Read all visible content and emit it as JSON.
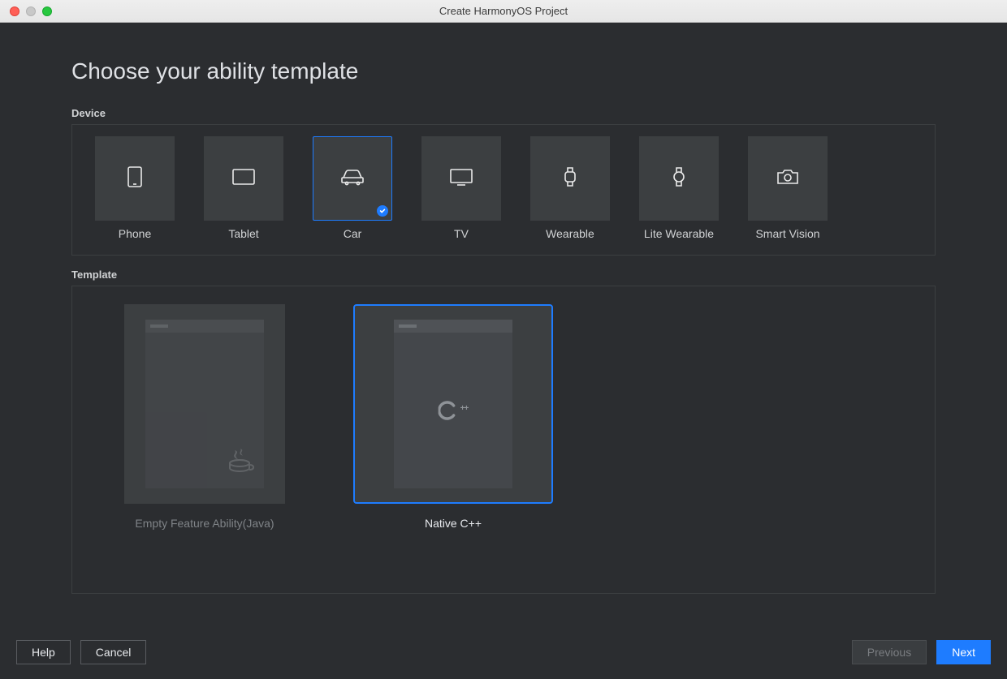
{
  "window": {
    "title": "Create HarmonyOS Project"
  },
  "page": {
    "title": "Choose your ability template"
  },
  "sections": {
    "device_label": "Device",
    "template_label": "Template"
  },
  "devices": [
    {
      "id": "phone",
      "label": "Phone",
      "icon": "phone-icon",
      "selected": false
    },
    {
      "id": "tablet",
      "label": "Tablet",
      "icon": "tablet-icon",
      "selected": false
    },
    {
      "id": "car",
      "label": "Car",
      "icon": "car-icon",
      "selected": true
    },
    {
      "id": "tv",
      "label": "TV",
      "icon": "tv-icon",
      "selected": false
    },
    {
      "id": "wearable",
      "label": "Wearable",
      "icon": "watch-icon",
      "selected": false
    },
    {
      "id": "lite-wearable",
      "label": "Lite Wearable",
      "icon": "lite-watch-icon",
      "selected": false
    },
    {
      "id": "smart-vision",
      "label": "Smart Vision",
      "icon": "camera-icon",
      "selected": false
    }
  ],
  "templates": [
    {
      "id": "empty-java",
      "label": "Empty Feature Ability(Java)",
      "selected": false,
      "badge": "java"
    },
    {
      "id": "native-cpp",
      "label": "Native C++",
      "selected": true,
      "badge": "cpp"
    }
  ],
  "footer": {
    "help": "Help",
    "cancel": "Cancel",
    "previous": "Previous",
    "next": "Next"
  },
  "colors": {
    "accent": "#1e7cff",
    "bg": "#2b2d30",
    "card": "#3c3f41"
  }
}
